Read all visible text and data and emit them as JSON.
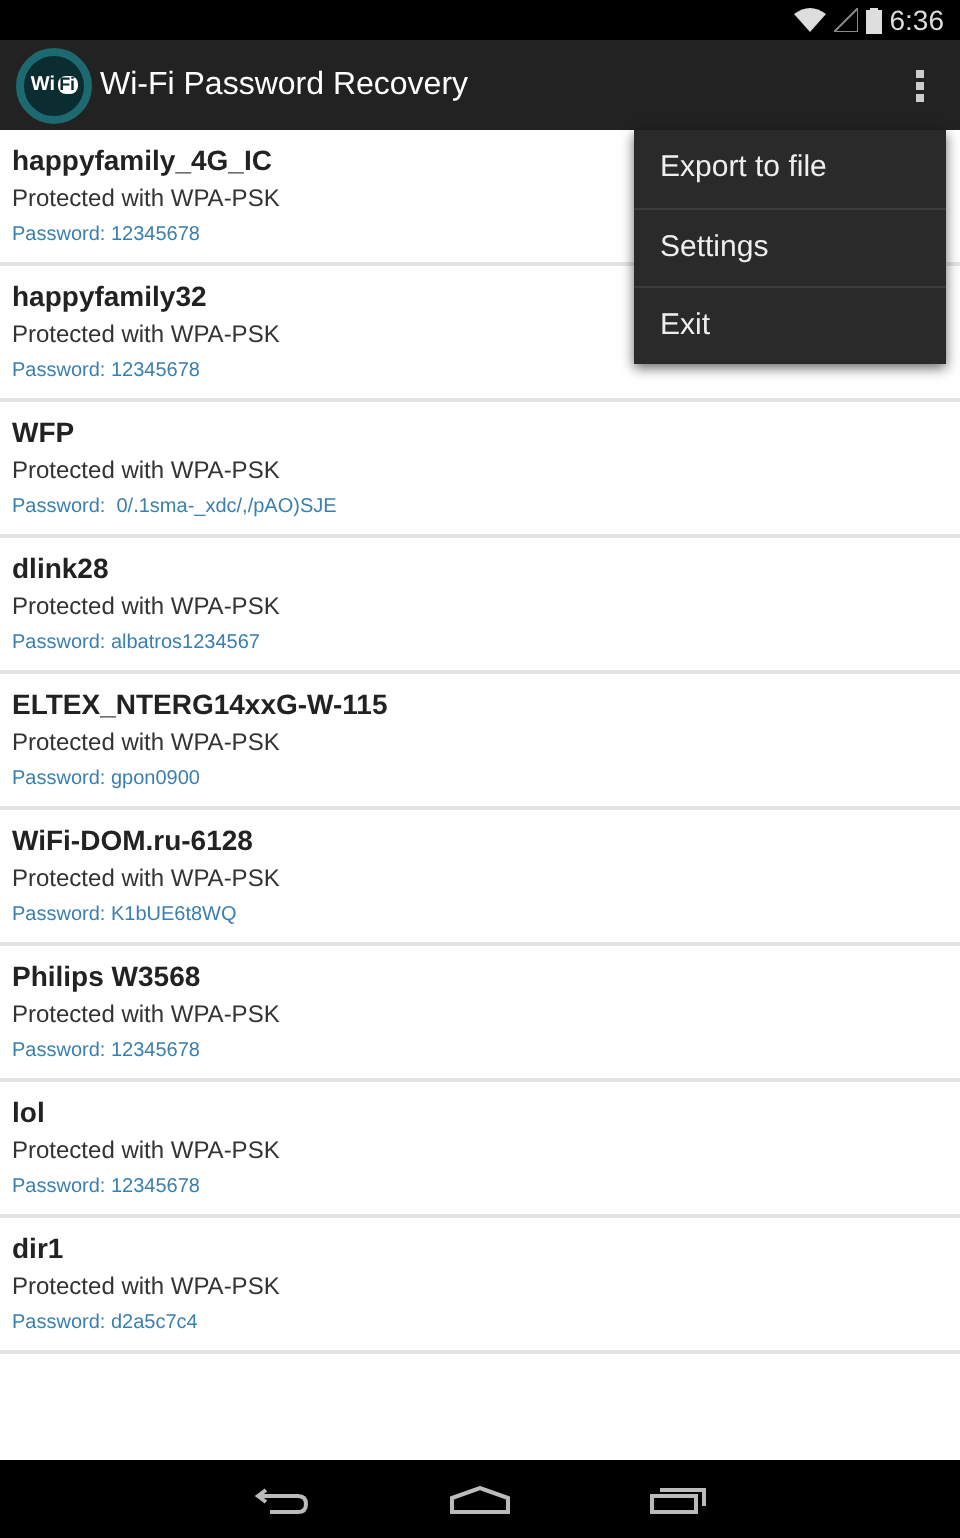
{
  "status_bar": {
    "time": "6:36"
  },
  "app_bar": {
    "logo": {
      "left": "Wi",
      "right": "Fi"
    },
    "title": "Wi-Fi Password Recovery"
  },
  "networks": [
    {
      "name": "happyfamily_4G_IC",
      "security": "Protected with WPA-PSK",
      "password": "Password: 12345678"
    },
    {
      "name": "happyfamily32",
      "security": "Protected with WPA-PSK",
      "password": "Password: 12345678"
    },
    {
      "name": "WFP",
      "security": "Protected with WPA-PSK",
      "password": "Password:  0/.1sma-_xdc/,/pAO)SJE"
    },
    {
      "name": "dlink28",
      "security": "Protected with WPA-PSK",
      "password": "Password: albatros1234567"
    },
    {
      "name": "ELTEX_NTERG14xxG-W-115",
      "security": "Protected with WPA-PSK",
      "password": "Password: gpon0900"
    },
    {
      "name": "WiFi-DOM.ru-6128",
      "security": "Protected with WPA-PSK",
      "password": "Password: K1bUE6t8WQ"
    },
    {
      "name": "Philips W3568",
      "security": "Protected with WPA-PSK",
      "password": "Password: 12345678"
    },
    {
      "name": "lol",
      "security": "Protected with WPA-PSK",
      "password": "Password: 12345678"
    },
    {
      "name": "dir1",
      "security": "Protected with WPA-PSK",
      "password": "Password: d2a5c7c4"
    }
  ],
  "overflow_menu": {
    "open": true,
    "items": [
      "Export to file",
      "Settings",
      "Exit"
    ]
  }
}
